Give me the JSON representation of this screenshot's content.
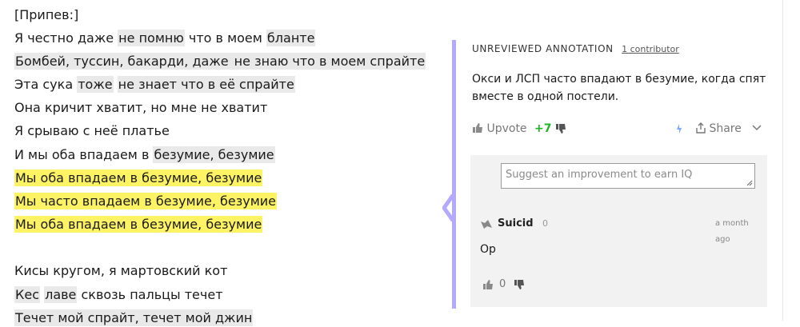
{
  "lyrics": {
    "chorus_label": "[Припев:]",
    "lines": [
      [
        {
          "t": "Я честно даже ",
          "h": ""
        },
        {
          "t": "не помню",
          "h": "g"
        },
        {
          "t": " что в моем ",
          "h": ""
        },
        {
          "t": "бланте",
          "h": "g"
        }
      ],
      [
        {
          "t": "Бомбей, туссин, бакарди, даже ",
          "h": "g"
        },
        {
          "t": "не знаю что в моем спрайте",
          "h": "g"
        }
      ],
      [
        {
          "t": "Эта сука ",
          "h": ""
        },
        {
          "t": "тоже",
          "h": "g"
        },
        {
          "t": " ",
          "h": ""
        },
        {
          "t": "не знает что в её спрайте",
          "h": "g"
        }
      ],
      [
        {
          "t": "Она кричит хватит, но мне не хватит",
          "h": ""
        }
      ],
      [
        {
          "t": "Я срываю с неё платье",
          "h": ""
        }
      ],
      [
        {
          "t": "И мы оба впадаем в ",
          "h": ""
        },
        {
          "t": "безумие, безумие",
          "h": "g"
        }
      ],
      [
        {
          "t": "Мы оба впадаем в безумие, безумие",
          "h": "y"
        }
      ],
      [
        {
          "t": "Мы часто впадаем в безумие, безумие",
          "h": "y"
        }
      ],
      [
        {
          "t": "Мы оба впадаем в безумие, безумие",
          "h": "y"
        }
      ],
      [
        {
          "t": "",
          "h": ""
        }
      ],
      [
        {
          "t": "Кисы кругом, я мартовский кот",
          "h": ""
        }
      ],
      [
        {
          "t": "Кес",
          "h": "g"
        },
        {
          "t": " ",
          "h": ""
        },
        {
          "t": "лаве",
          "h": "g"
        },
        {
          "t": " сквозь пальцы течет",
          "h": ""
        }
      ],
      [
        {
          "t": "Течет мой спрайт, течет мой джин",
          "h": "g"
        }
      ]
    ]
  },
  "annotation": {
    "label": "UNREVIEWED ANNOTATION",
    "contributors": "1 contributor",
    "body": "Окси и ЛСП часто впадают в безумие, когда спят вместе в одной постели.",
    "upvote_label": "Upvote",
    "votes": "+7",
    "share_label": "Share",
    "suggest_placeholder": "Suggest an improvement to earn IQ",
    "comment": {
      "author": "Suicid",
      "author_iq": "0",
      "time": "a month ago",
      "text": "Ор",
      "votes": "0"
    }
  },
  "colors": {
    "accent_bar": "#b3a9ff",
    "highlight_gray": "#e9e9e9",
    "highlight_yellow": "#fdf364",
    "votes_green": "#1cb824"
  }
}
